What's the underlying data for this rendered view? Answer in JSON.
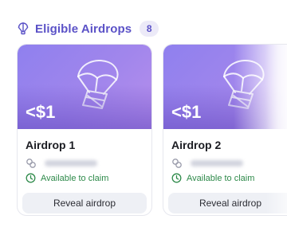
{
  "section": {
    "title": "Eligible Airdrops",
    "count": "8",
    "icon": "parachute-icon",
    "accent": "#5b52c7"
  },
  "airdrops": [
    {
      "value": "<$1",
      "name": "Airdrop 1",
      "status": "Available to claim",
      "button_label": "Reveal airdrop"
    },
    {
      "value": "<$1",
      "name": "Airdrop 2",
      "status": "Available to claim",
      "button_label": "Reveal airdrop"
    }
  ],
  "colors": {
    "banner_start": "#8f80ee",
    "banner_end": "#b78fec",
    "status_green": "#2e8a4a"
  }
}
